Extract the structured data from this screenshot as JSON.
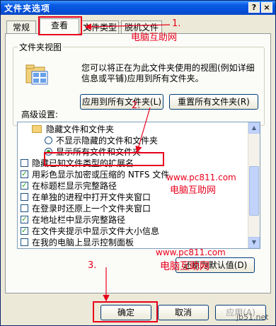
{
  "window": {
    "title": "文件夹选项",
    "help": "?",
    "close": "×"
  },
  "tabs": [
    {
      "label": "常规"
    },
    {
      "label": "查看"
    },
    {
      "label": "文件类型"
    },
    {
      "label": "脱机文件"
    }
  ],
  "views_group": {
    "legend": "文件夹视图",
    "description": "您可以将正在为此文件夹使用的视图(例如详细信息或平铺)应用到所有文件夹。",
    "apply_all": "应用到所有文件夹(L)",
    "reset_all": "重置所有文件夹(R)"
  },
  "advanced": {
    "label": "高级设置:",
    "items": [
      {
        "type": "folder",
        "label": "隐藏文件和文件夹"
      },
      {
        "type": "radio",
        "checked": false,
        "label": "不显示隐藏的文件和文件夹"
      },
      {
        "type": "radio",
        "checked": true,
        "label": "显示所有文件和文件夹"
      },
      {
        "type": "checkbox",
        "checked": false,
        "label": "隐藏已知文件类型的扩展名"
      },
      {
        "type": "checkbox",
        "checked": true,
        "label": "用彩色显示加密或压缩的 NTFS 文件"
      },
      {
        "type": "checkbox",
        "checked": true,
        "label": "在标题栏显示完整路径"
      },
      {
        "type": "checkbox",
        "checked": false,
        "label": "在单独的进程中打开文件夹窗口"
      },
      {
        "type": "checkbox",
        "checked": false,
        "label": "在登录时还原上一个文件夹窗口"
      },
      {
        "type": "checkbox",
        "checked": true,
        "label": "在地址栏中显示完整路径"
      },
      {
        "type": "checkbox",
        "checked": true,
        "label": "在文件夹提示中显示文件大小信息"
      },
      {
        "type": "checkbox",
        "checked": false,
        "label": "在我的电脑上显示控制面板"
      }
    ],
    "restore_default": "还原为默认值(D)"
  },
  "footer": {
    "ok": "确定",
    "cancel": "取消",
    "apply": "应用(A)"
  },
  "annotations": {
    "step1": "1.",
    "step2": "2.",
    "step3": "3."
  },
  "watermarks": {
    "site1": "www.pc811.com",
    "name1": "电脑互助网",
    "site2": "www.pc811.com",
    "name2": "电脑互助网",
    "corner": "jb51.net"
  },
  "colors": {
    "annotation_red": "#e8001c",
    "titlebar_blue": "#0550d8",
    "check_green": "#21a121"
  }
}
